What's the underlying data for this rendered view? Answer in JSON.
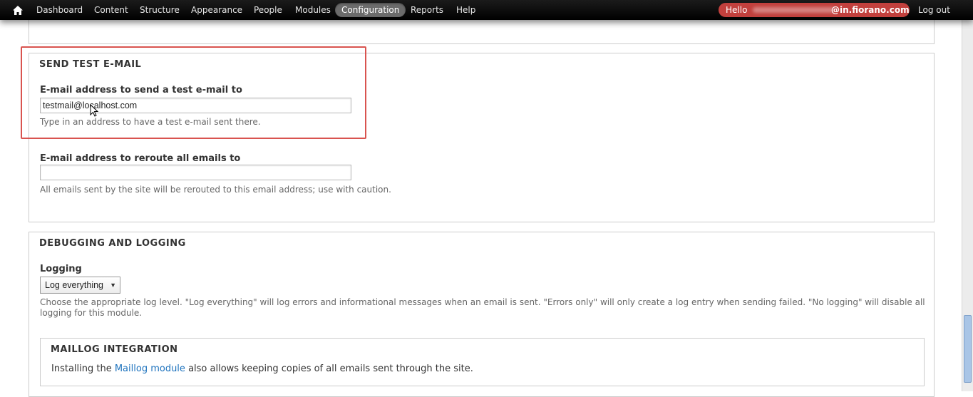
{
  "toolbar": {
    "items": [
      "Dashboard",
      "Content",
      "Structure",
      "Appearance",
      "People",
      "Modules",
      "Configuration",
      "Reports",
      "Help"
    ],
    "active_item": "Configuration",
    "hello_prefix": "Hello",
    "user_domain": "@in.fiorano.com",
    "logout": "Log out",
    "home_icon": "home-icon"
  },
  "test_email": {
    "legend": "SEND TEST E-MAIL",
    "label": "E-mail address to send a test e-mail to",
    "value": "testmail@localhost.com",
    "description": "Type in an address to have a test e-mail sent there."
  },
  "reroute": {
    "label": "E-mail address to reroute all emails to",
    "value": "",
    "description": "All emails sent by the site will be rerouted to this email address; use with caution."
  },
  "debugging": {
    "legend": "DEBUGGING AND LOGGING",
    "logging_label": "Logging",
    "logging_selected": "Log everything",
    "description": "Choose the appropriate log level. \"Log everything\" will log errors and informational messages when an email is sent. \"Errors only\" will only create a log entry when sending failed. \"No logging\" will disable all logging for this module."
  },
  "maillog": {
    "legend": "MAILLOG INTEGRATION",
    "text_before": "Installing the",
    "link": "Maillog module",
    "text_after": "also allows keeping copies of all emails sent through the site."
  },
  "colors": {
    "toolbar_bg": "#000000",
    "hello_pill": "#c2403d",
    "highlight_border": "#d9534f",
    "link": "#1e73be"
  }
}
